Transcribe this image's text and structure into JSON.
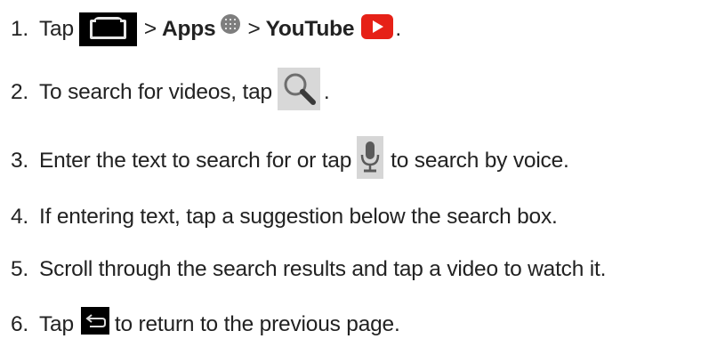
{
  "steps": [
    {
      "number": "1.",
      "tap": "Tap",
      "sep1": ">",
      "apps": "Apps",
      "sep2": ">",
      "youtube": "YouTube",
      "end": "."
    },
    {
      "number": "2.",
      "text": "To search for videos, tap",
      "end": "."
    },
    {
      "number": "3.",
      "text_before": "Enter the text to search for or tap",
      "text_after": "to search by voice."
    },
    {
      "number": "4.",
      "text": "If entering text, tap a suggestion below the search box."
    },
    {
      "number": "5.",
      "text": "Scroll through the search results and tap a video to watch it."
    },
    {
      "number": "6.",
      "text_before": "Tap",
      "text_after": "to return to the previous page."
    }
  ],
  "icons": {
    "home": "home-icon",
    "apps": "apps-icon",
    "youtube": "youtube-icon",
    "search": "search-icon",
    "microphone": "microphone-icon",
    "back": "back-icon"
  },
  "colors": {
    "text": "#222222",
    "youtube_red": "#e62117",
    "icon_dark": "#000000",
    "icon_gray": "#7e7e7e"
  }
}
